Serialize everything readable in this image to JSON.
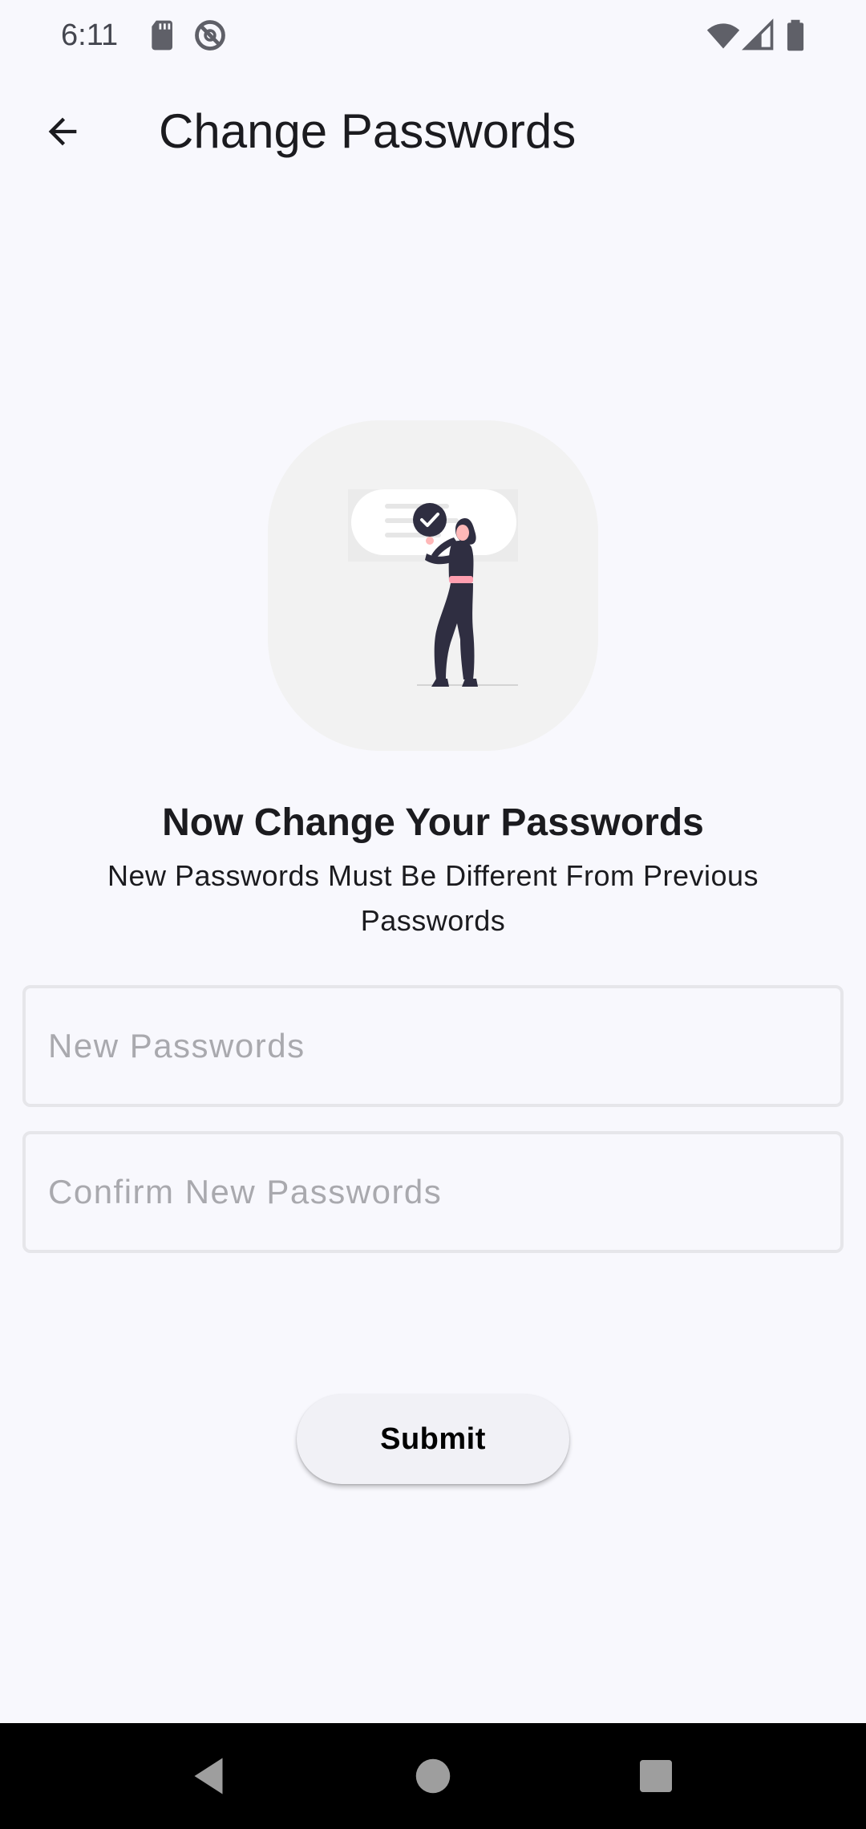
{
  "status_bar": {
    "time": "6:11",
    "left_icons": [
      "sd-card-icon",
      "do-not-disturb-icon"
    ],
    "right_icons": [
      "wifi-icon",
      "cellular-signal-icon",
      "battery-icon"
    ]
  },
  "app_bar": {
    "title": "Change Passwords",
    "back_icon": "arrow-back-icon"
  },
  "illustration": {
    "icon": "checkmark-icon",
    "accent_color": "#2f2e41",
    "highlight_color": "#ff6584"
  },
  "content": {
    "heading": "Now Change Your Passwords",
    "subheading": "New Passwords Must Be Different From Previous Passwords"
  },
  "form": {
    "new_password": {
      "placeholder": "New Passwords",
      "value": ""
    },
    "confirm_password": {
      "placeholder": "Confirm New Passwords",
      "value": ""
    },
    "submit_label": "Submit"
  },
  "nav_bar": {
    "buttons": [
      "back-triangle-icon",
      "home-circle-icon",
      "recents-square-icon"
    ]
  }
}
